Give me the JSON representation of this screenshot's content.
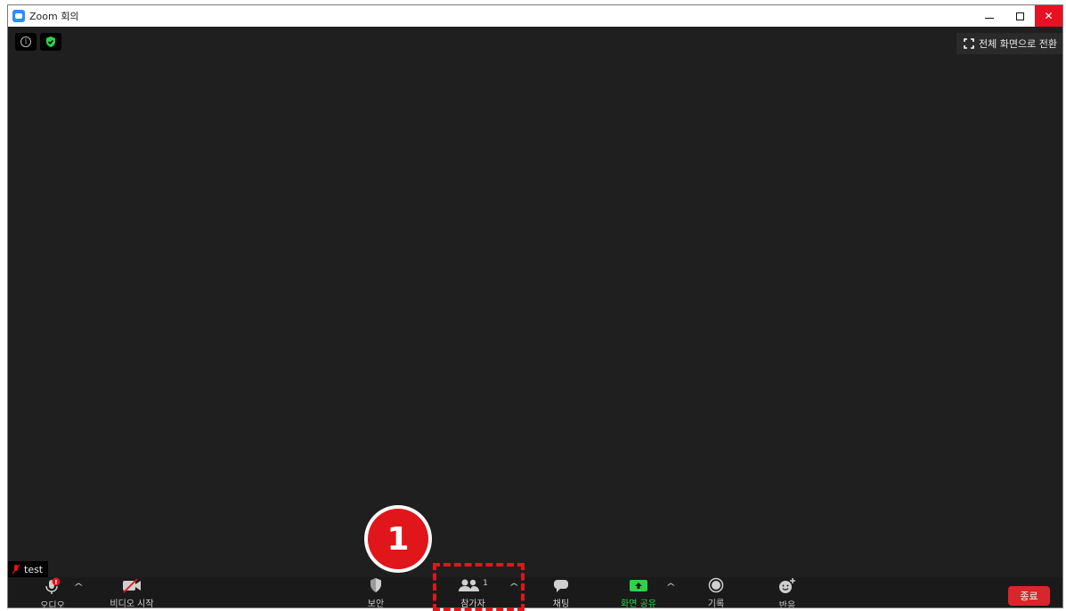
{
  "window": {
    "title": "Zoom 회의",
    "controls": {
      "minimize": "minimize-icon",
      "maximize": "maximize-icon",
      "close": "✕"
    }
  },
  "video": {
    "top_left_icons": [
      "info-icon",
      "shield-check-icon"
    ],
    "fullscreen_label": "전체 화면으로 전환",
    "participant_name": "test",
    "participant_muted": true
  },
  "toolbar": {
    "audio_label": "오디오",
    "video_label": "비디오 시작",
    "security_label": "보안",
    "participants_label": "참가자",
    "participants_count": "1",
    "chat_label": "채팅",
    "share_label": "화면 공유",
    "record_label": "기록",
    "reactions_label": "반응",
    "end_label": "종료",
    "audio_alert": "!"
  },
  "annotation": {
    "step_number": "1",
    "accent_color": "#e0161b"
  },
  "colors": {
    "background": "#1f1f1f",
    "toolbar": "#1a1a1a",
    "share_green": "#2ed34a",
    "end_red": "#d9262c",
    "zoom_blue": "#2d8cff"
  }
}
